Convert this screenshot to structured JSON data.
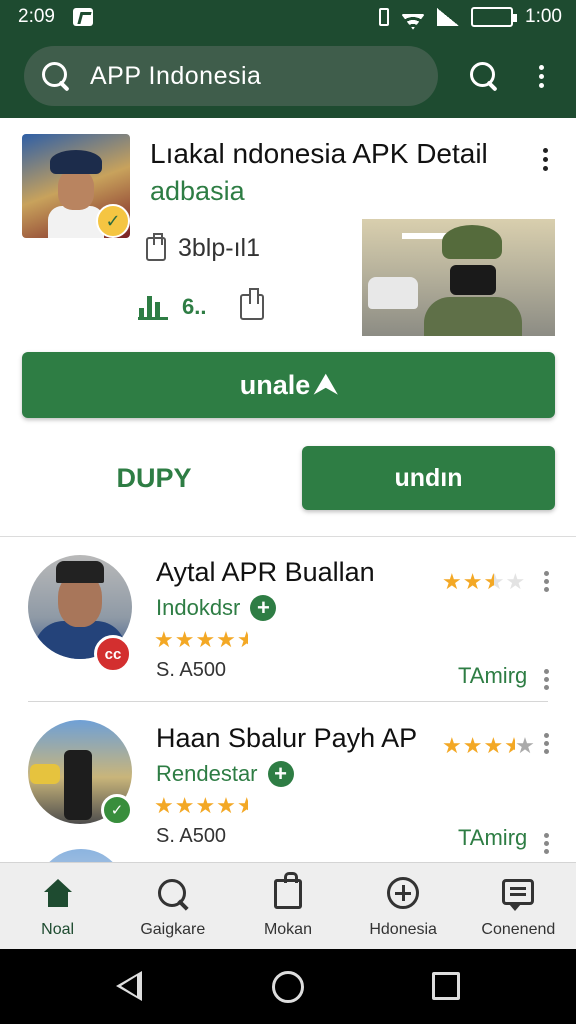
{
  "status_bar": {
    "time": "2:09",
    "battery": "",
    "clock_right": "1:00"
  },
  "search": {
    "query": "APP Indonesia"
  },
  "detail": {
    "title": "Lıakal ndonesia APK Detail",
    "developer": "adbasia",
    "size": "3blp-ıl1",
    "rating_count": "6..",
    "install_label": "unale",
    "secondary_text_button": "DUPY",
    "secondary_button": "undın"
  },
  "list": [
    {
      "title": "Aytal APR Buallan",
      "developer": "Indokdsr",
      "rating": 4.5,
      "header_rating": 2.5,
      "size": "S. A500",
      "tag": "TAmirg",
      "badge": "cc"
    },
    {
      "title": "Haan Sbalur Payh AP",
      "developer": "Rendestar",
      "rating": 4.5,
      "header_rating": 3.5,
      "size": "S. A500",
      "tag": "TAmirg",
      "badge": "✓"
    }
  ],
  "bottom_nav": [
    {
      "label": "Noal",
      "icon": "home-icon",
      "active": true
    },
    {
      "label": "Gaigkare",
      "icon": "search-icon",
      "active": false
    },
    {
      "label": "Mokan",
      "icon": "bag-icon",
      "active": false
    },
    {
      "label": "Hdonesia",
      "icon": "add-circle-icon",
      "active": false
    },
    {
      "label": "Conenend",
      "icon": "chat-icon",
      "active": false
    }
  ],
  "colors": {
    "primary": "#2e7d44",
    "app_bar": "#1e4b30",
    "star": "#f3a825"
  }
}
